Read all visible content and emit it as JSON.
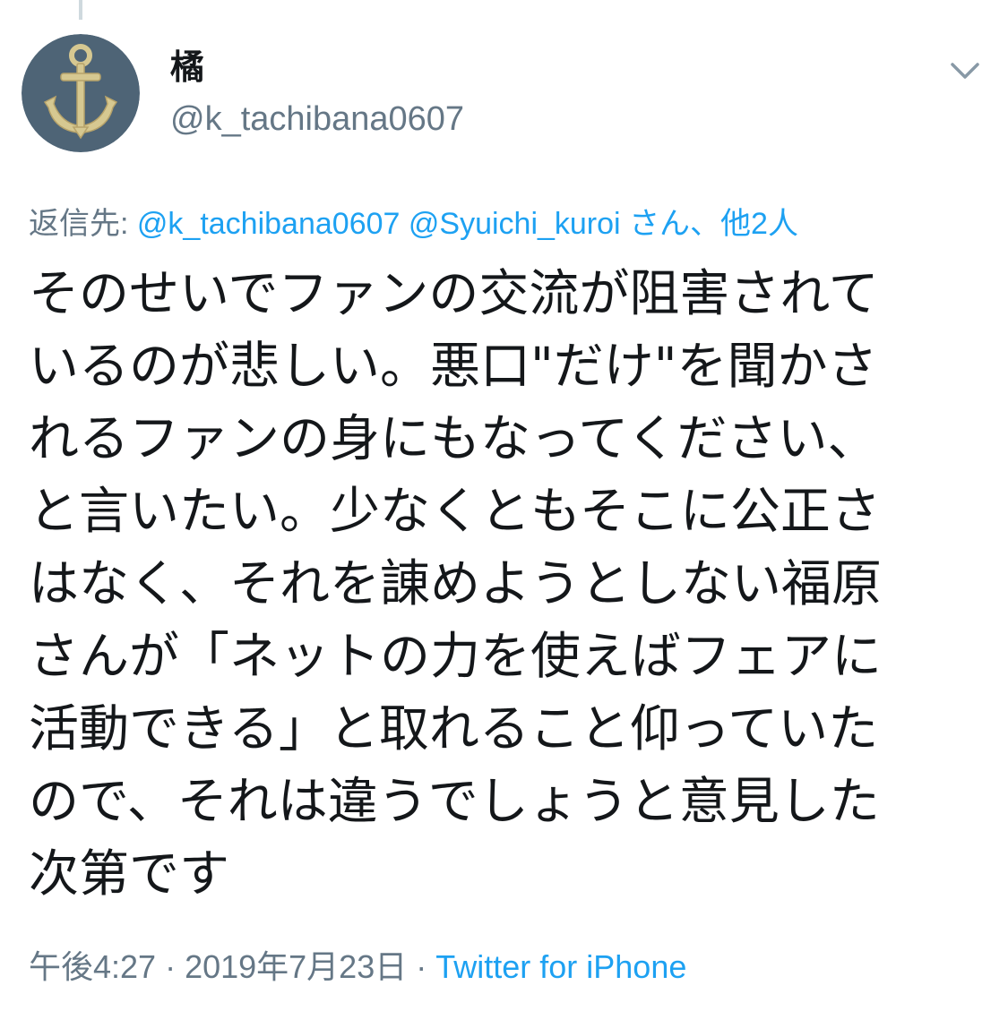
{
  "tweet": {
    "author": {
      "display_name": "橘",
      "handle": "@k_tachibana0607",
      "avatar_icon": "anchor-icon"
    },
    "menu_icon": "chevron-down-icon",
    "reply_to": {
      "prefix": "返信先: ",
      "mentions": [
        "@k_tachibana0607",
        "@Syuichi_kuroi"
      ],
      "suffix": "さん、他2人"
    },
    "body_lines": [
      "そのせいでファンの交流が阻害されて",
      "いるのが悲しい。悪口\"だけ\"を聞かさ",
      "れるファンの身にもなってください、",
      "と言いたい。少なくともそこに公正さ",
      "はなく、それを諌めようとしない福原",
      "さんが「ネットの力を使えばフェアに",
      "活動できる」と取れること仰っていた",
      "ので、それは違うでしょうと意見した",
      "次第です"
    ],
    "meta": {
      "time": "午後4:27",
      "separator": " · ",
      "date": "2019年7月23日",
      "source": "Twitter for iPhone"
    }
  },
  "colors": {
    "text": "#14171a",
    "secondary": "#657786",
    "link": "#1da1f2",
    "avatar_bg": "#4e6476",
    "anchor_gold": "#d6c891"
  }
}
